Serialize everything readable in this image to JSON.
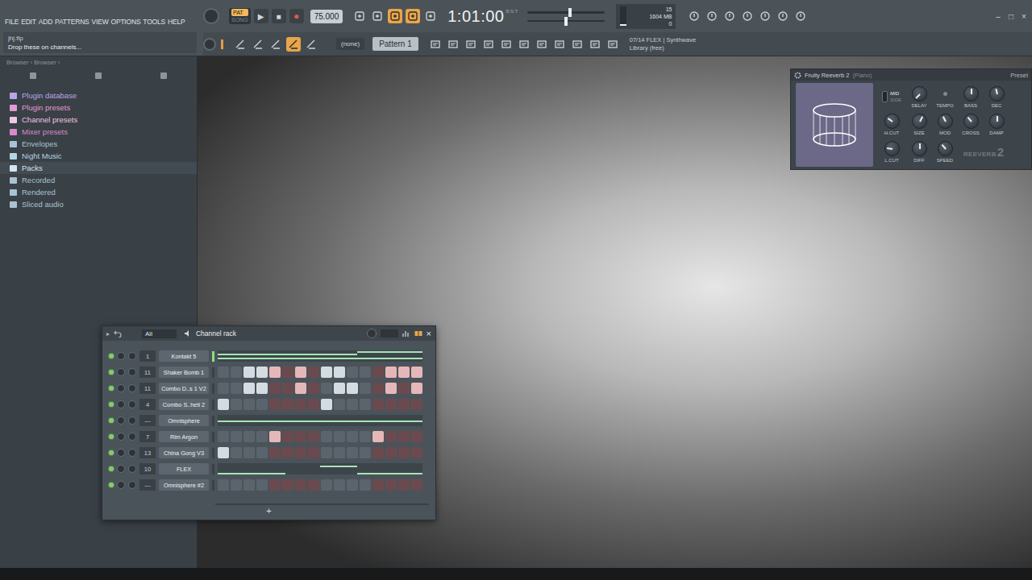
{
  "menu": [
    "FILE",
    "EDIT",
    "ADD",
    "PATTERNS",
    "VIEW",
    "OPTIONS",
    "TOOLS",
    "HELP"
  ],
  "hint": {
    "file": "jhj.flp",
    "message": "Drop these on channels..."
  },
  "transport": {
    "modes": [
      {
        "label": "PAT",
        "selected": true
      },
      {
        "label": "SONG",
        "selected": false
      }
    ],
    "play": "▶",
    "stop": "■",
    "record": "●",
    "tempo": "75.000",
    "time": "1:01:00",
    "time_unit": "B:S:T",
    "master_volume": 0.55,
    "master_pitch": 0.5,
    "cpu": "15",
    "cpu_level": 0.1,
    "memory": "1604 MB",
    "polyphony": "0",
    "options": [
      {
        "on": false
      },
      {
        "on": false
      },
      {
        "on": true
      },
      {
        "on": true
      },
      {
        "on": false
      }
    ]
  },
  "edit_options": [
    {
      "on": false
    },
    {
      "on": false
    },
    {
      "on": false
    },
    {
      "on": true
    },
    {
      "on": false
    }
  ],
  "pattern": {
    "channel_select": "(none)",
    "current": "Pattern 1"
  },
  "news": {
    "title": "07/14 FLEX | Synthwave",
    "subtitle": "Library (free)"
  },
  "window_controls": [
    "–",
    "□",
    "×"
  ],
  "browser": {
    "path": "Browser › Browser ›",
    "items": [
      {
        "label": "Plugin database",
        "selected": false,
        "color": "#b9a4e6"
      },
      {
        "label": "Plugin presets",
        "selected": false,
        "color": "#e39ad2"
      },
      {
        "label": "Channel presets",
        "selected": false,
        "color": "#f0c6e4"
      },
      {
        "label": "Mixer presets",
        "selected": false,
        "color": "#d889c9"
      },
      {
        "label": "Envelopes",
        "selected": false,
        "color": "#a9c3d3"
      },
      {
        "label": "Night Music",
        "selected": false,
        "color": "#b6d4e4"
      },
      {
        "label": "Packs",
        "selected": true,
        "color": "#d4e4f0"
      },
      {
        "label": "Recorded",
        "selected": false,
        "color": "#a9c3d3"
      },
      {
        "label": "Rendered",
        "selected": false,
        "color": "#a9c3d3"
      },
      {
        "label": "Sliced audio",
        "selected": false,
        "color": "#a9c3d3"
      }
    ]
  },
  "channel_rack": {
    "arrow": "▸",
    "filter": "All",
    "title": "Channel rack",
    "close": "×",
    "add": "+",
    "channels": [
      {
        "name": "Kontakt 5",
        "number": "1",
        "kind": "roll",
        "selected": true,
        "enabled": true,
        "steps": [],
        "notes": [
          {
            "start": 0,
            "end": 0.68,
            "pitch": 0.3
          },
          {
            "start": 0.68,
            "end": 1,
            "pitch": 0.1
          },
          {
            "start": 0,
            "end": 1,
            "pitch": 0.65
          }
        ]
      },
      {
        "name": "Shaker Bomb 1",
        "number": "11",
        "kind": "steps",
        "selected": false,
        "enabled": true,
        "notes": [],
        "steps": [
          false,
          false,
          true,
          true,
          true,
          false,
          true,
          false,
          true,
          true,
          false,
          false,
          false,
          true,
          true,
          true
        ]
      },
      {
        "name": "Combo D..s 1 V2",
        "number": "11",
        "kind": "steps",
        "selected": false,
        "enabled": true,
        "notes": [],
        "steps": [
          false,
          false,
          true,
          true,
          false,
          false,
          true,
          false,
          false,
          true,
          true,
          false,
          false,
          true,
          false,
          true
        ]
      },
      {
        "name": "Combo S..heti 2",
        "number": "4",
        "kind": "steps",
        "selected": false,
        "enabled": true,
        "notes": [],
        "steps": [
          true,
          false,
          false,
          false,
          false,
          false,
          false,
          false,
          true,
          false,
          false,
          false,
          false,
          false,
          false,
          false
        ]
      },
      {
        "name": "Omnisphere",
        "number": "---",
        "kind": "roll",
        "selected": false,
        "enabled": true,
        "steps": [],
        "notes": [
          {
            "start": 0,
            "end": 1,
            "pitch": 0.5
          }
        ]
      },
      {
        "name": "Rim Argon",
        "number": "7",
        "kind": "steps",
        "selected": false,
        "enabled": true,
        "notes": [],
        "steps": [
          false,
          false,
          false,
          false,
          true,
          false,
          false,
          false,
          false,
          false,
          false,
          false,
          true,
          false,
          false,
          false
        ]
      },
      {
        "name": "China Gong V3",
        "number": "13",
        "kind": "steps",
        "selected": false,
        "enabled": true,
        "notes": [],
        "steps": [
          true,
          false,
          false,
          false,
          false,
          false,
          false,
          false,
          false,
          false,
          false,
          false,
          false,
          false,
          false,
          false
        ]
      },
      {
        "name": "FLEX",
        "number": "10",
        "kind": "roll",
        "selected": false,
        "enabled": true,
        "steps": [],
        "notes": [
          {
            "start": 0.5,
            "end": 0.68,
            "pitch": 0.2
          },
          {
            "start": 0,
            "end": 0.33,
            "pitch": 0.85
          },
          {
            "start": 0.68,
            "end": 1,
            "pitch": 0.85
          }
        ]
      },
      {
        "name": "Omnisphere #2",
        "number": "---",
        "kind": "steps",
        "selected": false,
        "enabled": true,
        "notes": [],
        "steps": [
          false,
          false,
          false,
          false,
          false,
          false,
          false,
          false,
          false,
          false,
          false,
          false,
          false,
          false,
          false,
          false
        ]
      }
    ]
  },
  "reverb": {
    "title": "Fruity Reeverb 2",
    "preset": "(Piano)",
    "presets": "Preset",
    "modes": [
      {
        "label": "MID",
        "selected": true
      },
      {
        "label": "SIDE",
        "selected": false
      }
    ],
    "knobs": [
      {
        "label": "DELAY",
        "kind": "big",
        "level": 0.0
      },
      {
        "label": "TEMPO",
        "kind": "small",
        "level": 0.0
      },
      {
        "label": "BASS",
        "kind": "big",
        "level": 0.5
      },
      {
        "label": "DEC",
        "kind": "big",
        "level": 0.45
      },
      {
        "label": "H.CUT",
        "kind": "big",
        "level": 0.3
      },
      {
        "label": "SIZE",
        "kind": "big",
        "level": 0.6
      },
      {
        "label": "MOD",
        "kind": "big",
        "level": 0.4
      },
      {
        "label": "CROSS",
        "kind": "big",
        "level": 0.35
      },
      {
        "label": "DAMP",
        "kind": "big",
        "level": 0.5
      },
      {
        "label": "L.CUT",
        "kind": "big",
        "level": 0.2
      },
      {
        "label": "DIFF",
        "kind": "big",
        "level": 0.5
      },
      {
        "label": "SPEED",
        "kind": "big",
        "level": 0.35
      }
    ],
    "logo": "REEVERB",
    "logo_number": "2"
  }
}
